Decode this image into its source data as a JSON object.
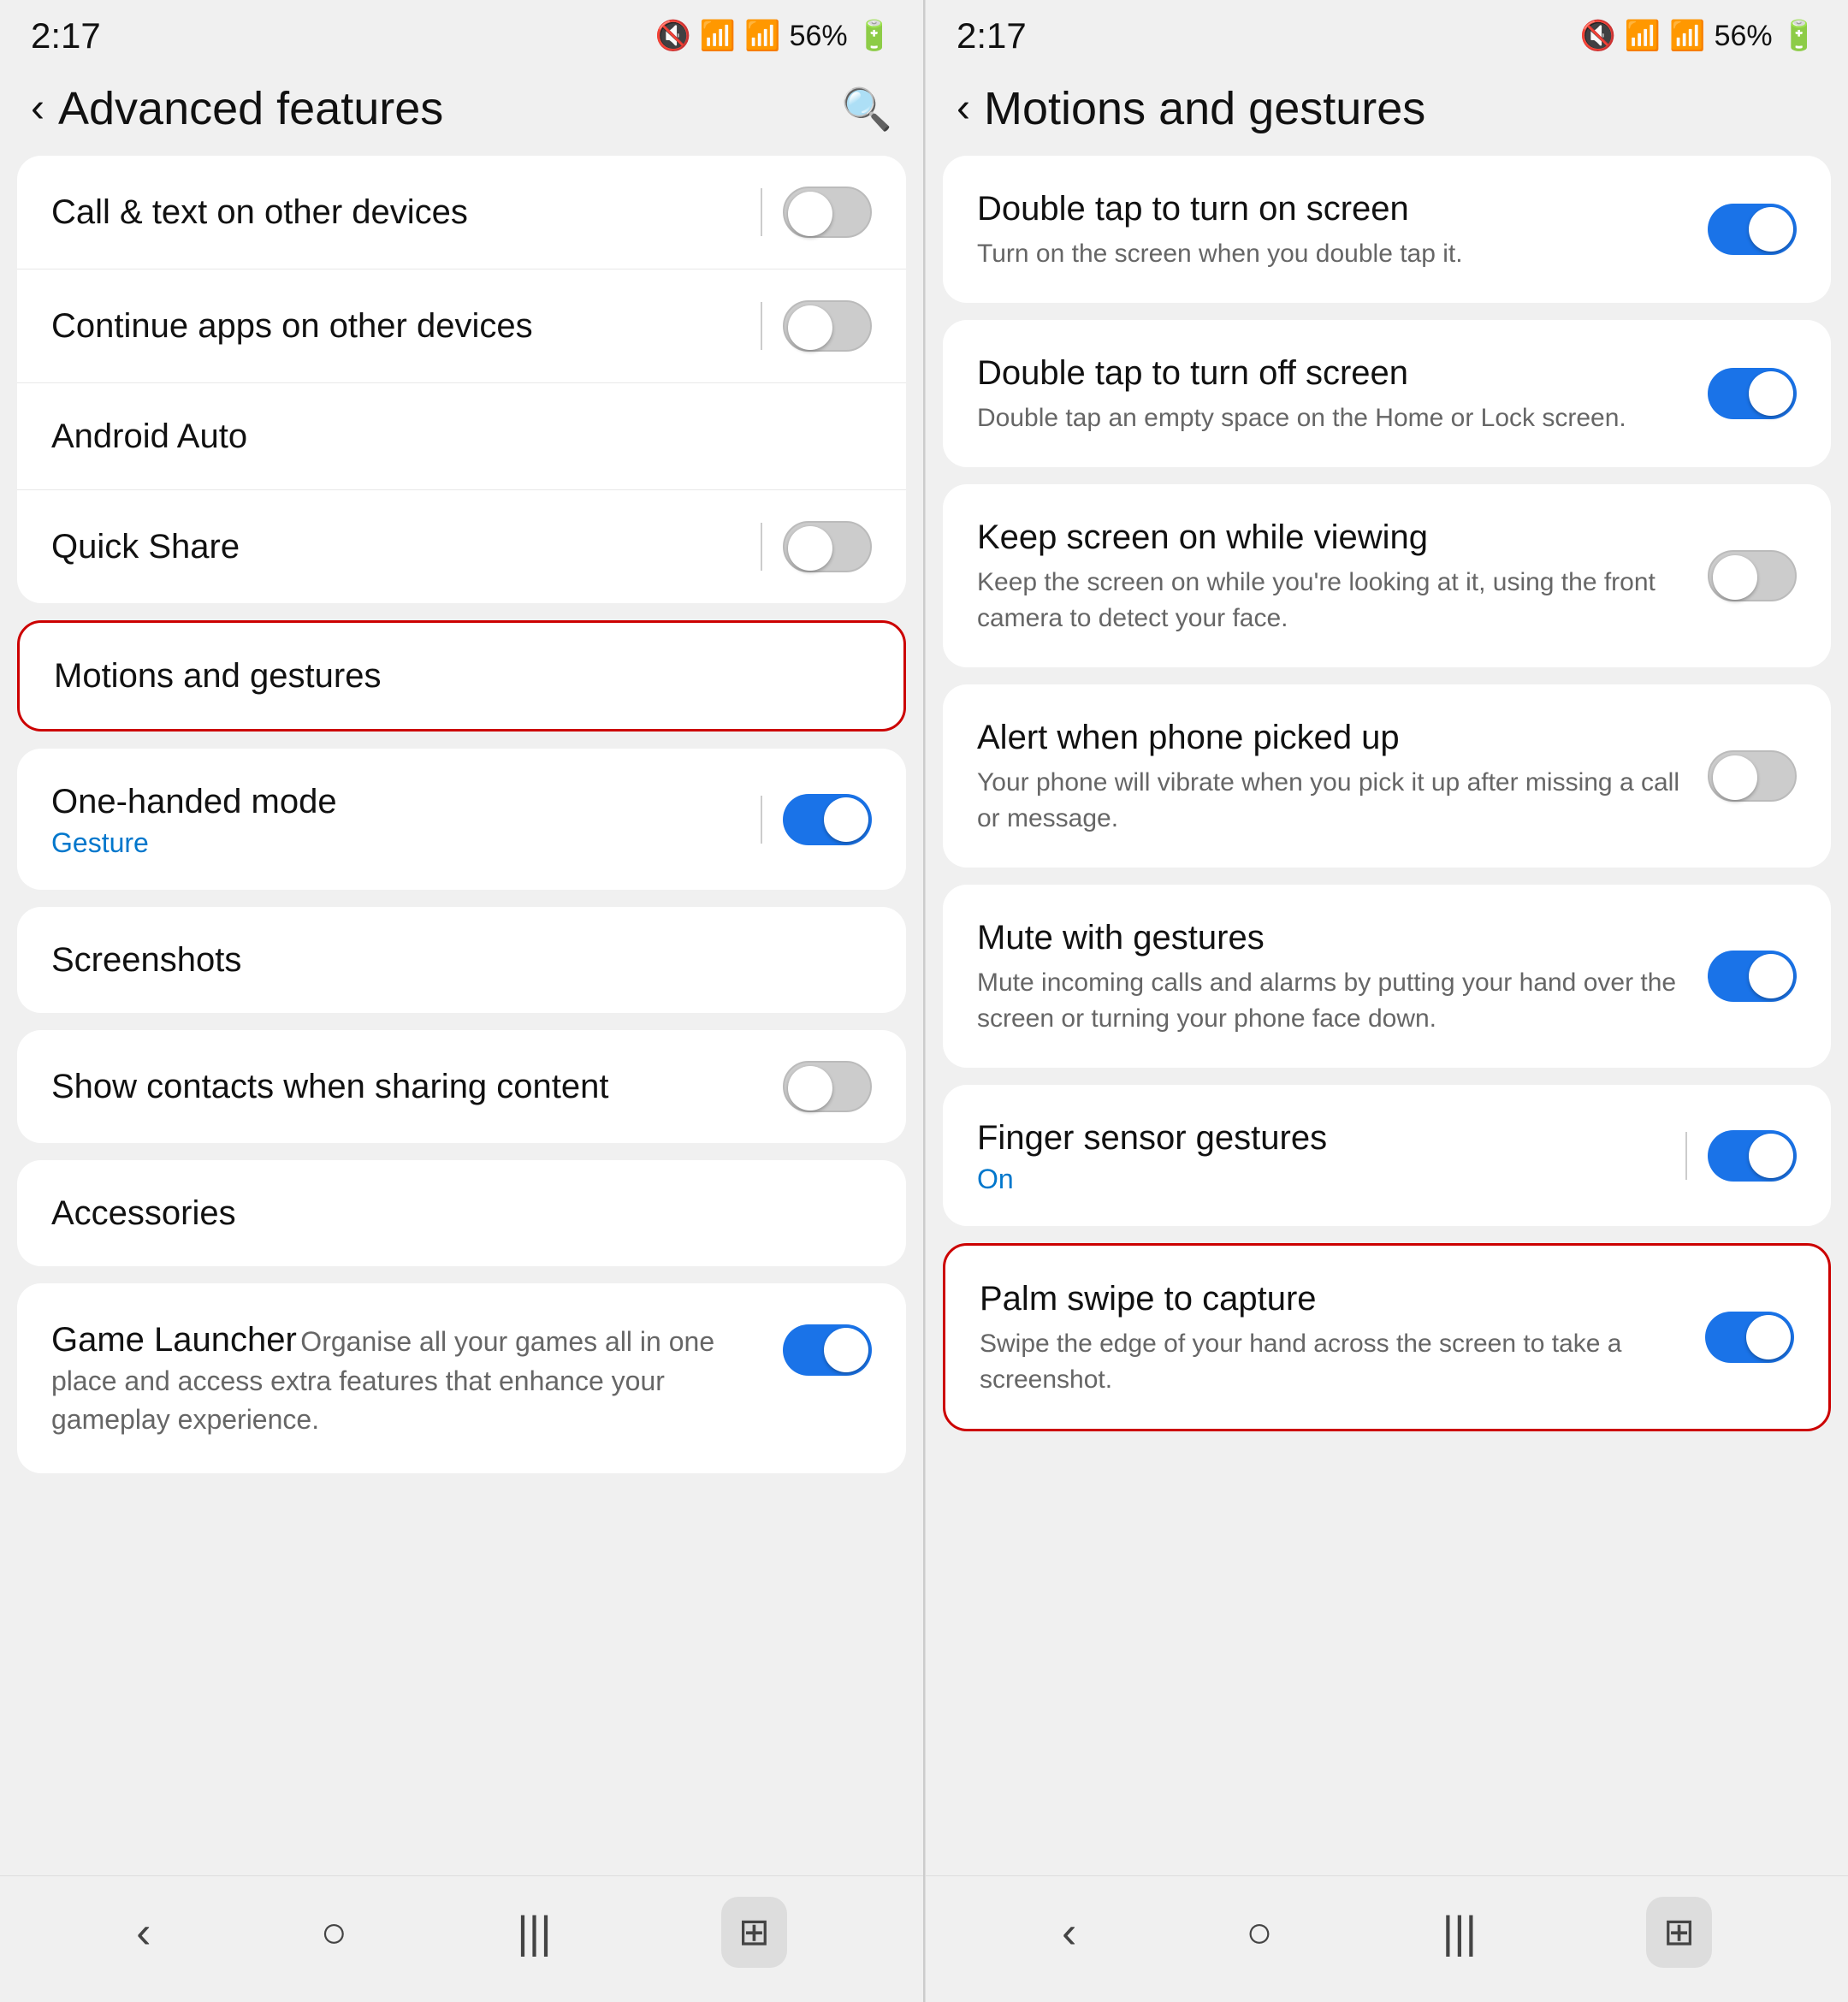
{
  "left": {
    "statusBar": {
      "time": "2:17",
      "batteryText": "56%"
    },
    "header": {
      "title": "Advanced features",
      "backArrow": "‹",
      "searchLabel": "search"
    },
    "items": [
      {
        "label": "Call & text on other devices",
        "hasToggle": true,
        "toggleOn": false,
        "hasDivider": true,
        "highlighted": false
      },
      {
        "label": "Continue apps on other devices",
        "hasToggle": true,
        "toggleOn": false,
        "hasDivider": true,
        "highlighted": false
      },
      {
        "label": "Android Auto",
        "hasToggle": false,
        "highlighted": false
      },
      {
        "label": "Quick Share",
        "hasToggle": true,
        "toggleOn": false,
        "hasDivider": true,
        "highlighted": false
      }
    ],
    "motionsItem": {
      "label": "Motions and gestures",
      "highlighted": true
    },
    "oneHandedItem": {
      "label": "One-handed mode",
      "sublabel": "Gesture",
      "toggleOn": true,
      "hasDivider": true
    },
    "screenshotsItem": {
      "label": "Screenshots"
    },
    "showContactsItem": {
      "label": "Show contacts when sharing content",
      "toggleOn": false
    },
    "accessoriesItem": {
      "label": "Accessories"
    },
    "gameLauncherItem": {
      "label": "Game Launcher",
      "desc": "Organise all your games all in one place and access extra features that enhance your gameplay experience.",
      "toggleOn": true
    },
    "navBar": {
      "backIcon": "‹",
      "homeIcon": "○",
      "recentIcon": "|||",
      "qrIcon": "⊞"
    }
  },
  "right": {
    "statusBar": {
      "time": "2:17",
      "batteryText": "56%"
    },
    "header": {
      "title": "Motions and gestures",
      "backArrow": "‹"
    },
    "items": [
      {
        "id": "double-tap-on",
        "label": "Double tap to turn on screen",
        "desc": "Turn on the screen when you double tap it.",
        "toggleOn": true,
        "hasDivider": false,
        "highlighted": false
      },
      {
        "id": "double-tap-off",
        "label": "Double tap to turn off screen",
        "desc": "Double tap an empty space on the Home or Lock screen.",
        "toggleOn": true,
        "hasDivider": false,
        "highlighted": false
      },
      {
        "id": "keep-screen",
        "label": "Keep screen on while viewing",
        "desc": "Keep the screen on while you're looking at it, using the front camera to detect your face.",
        "toggleOn": false,
        "hasDivider": false,
        "highlighted": false
      },
      {
        "id": "alert-pickup",
        "label": "Alert when phone picked up",
        "desc": "Your phone will vibrate when you pick it up after missing a call or message.",
        "toggleOn": false,
        "hasDivider": false,
        "highlighted": false
      },
      {
        "id": "mute-gestures",
        "label": "Mute with gestures",
        "desc": "Mute incoming calls and alarms by putting your hand over the screen or turning your phone face down.",
        "toggleOn": true,
        "hasDivider": false,
        "highlighted": false
      },
      {
        "id": "finger-sensor",
        "label": "Finger sensor gestures",
        "sublabel": "On",
        "toggleOn": true,
        "hasDivider": true,
        "highlighted": false
      },
      {
        "id": "palm-swipe",
        "label": "Palm swipe to capture",
        "desc": "Swipe the edge of your hand across the screen to take a screenshot.",
        "toggleOn": true,
        "hasDivider": false,
        "highlighted": true
      }
    ],
    "navBar": {
      "backIcon": "‹",
      "homeIcon": "○",
      "recentIcon": "|||",
      "qrIcon": "⊞"
    }
  }
}
